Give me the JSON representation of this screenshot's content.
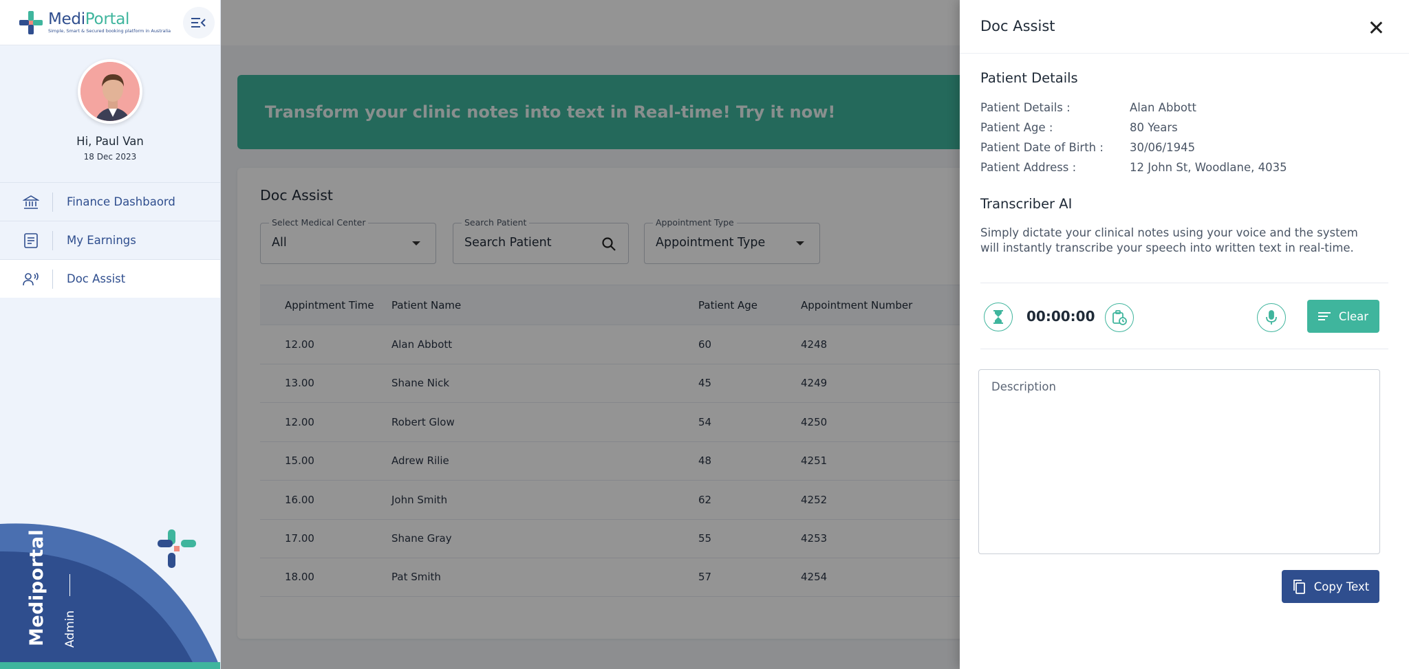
{
  "colors": {
    "brand_blue": "#2f4e8e",
    "brand_teal": "#3fb59d",
    "sidebar_bg": "#eef3fb"
  },
  "logo": {
    "title_part1": "Medi",
    "title_part2": "Portal",
    "tagline": "Simple, Smart & Secured booking platform in Australia"
  },
  "profile": {
    "greeting": "Hi, Paul Van",
    "date": "18 Dec 2023"
  },
  "sidebar": {
    "items": [
      {
        "label": "Finance Dashbaord",
        "icon": "bank-icon"
      },
      {
        "label": "My Earnings",
        "icon": "document-icon"
      },
      {
        "label": "Doc Assist",
        "icon": "voice-user-icon",
        "active": true
      }
    ],
    "brand": "Mediportal",
    "role": "Admin"
  },
  "banner": {
    "text": "Transform your clinic notes into text in Real-time! Try it now!"
  },
  "main": {
    "title": "Doc Assist",
    "filters": {
      "medical_center": {
        "label": "Select Medical Center",
        "value": "All"
      },
      "search": {
        "label": "Search Patient",
        "placeholder": "Search Patient"
      },
      "appointment_type": {
        "label": "Appointment Type",
        "value": "Appointment Type"
      }
    },
    "table": {
      "headers": [
        "Appintment Time",
        "Patient Name",
        "Patient Age",
        "Appointment Number"
      ],
      "rows": [
        [
          "12.00",
          "Alan Abbott",
          "60",
          "4248"
        ],
        [
          "13.00",
          "Shane Nick",
          "45",
          "4249"
        ],
        [
          "12.00",
          "Robert Glow",
          "54",
          "4250"
        ],
        [
          "15.00",
          "Adrew Rilie",
          "48",
          "4251"
        ],
        [
          "16.00",
          "John Smith",
          "62",
          "4252"
        ],
        [
          "17.00",
          "Shane Gray",
          "55",
          "4253"
        ],
        [
          "18.00",
          "Pat Smith",
          "57",
          "4254"
        ]
      ]
    }
  },
  "drawer": {
    "title": "Doc Assist",
    "patient_section_title": "Patient Details",
    "details": [
      {
        "label": "Patient Details :",
        "value": "Alan Abbott"
      },
      {
        "label": "Patient Age :",
        "value": "80 Years"
      },
      {
        "label": "Patient Date of Birth :",
        "value": "30/06/1945"
      },
      {
        "label": "Patient Address :",
        "value": "12 John St, Woodlane, 4035"
      }
    ],
    "transcriber_title": "Transcriber AI",
    "transcriber_intro": "Simply dictate your clinical notes using your voice and the system will instantly transcribe your speech into written text in real-time.",
    "timer": "00:00:00",
    "clear_label": "Clear",
    "description_placeholder": "Description",
    "copy_label": "Copy Text"
  }
}
